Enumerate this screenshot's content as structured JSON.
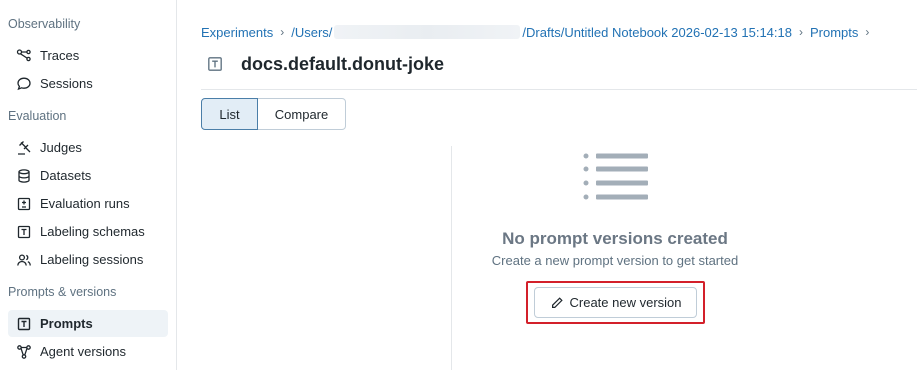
{
  "sidebar": {
    "sections": [
      {
        "title": "Observability",
        "items": [
          {
            "label": "Traces",
            "icon": "traces-icon"
          },
          {
            "label": "Sessions",
            "icon": "chat-bubble-icon"
          }
        ]
      },
      {
        "title": "Evaluation",
        "items": [
          {
            "label": "Judges",
            "icon": "gavel-icon"
          },
          {
            "label": "Datasets",
            "icon": "database-icon"
          },
          {
            "label": "Evaluation runs",
            "icon": "plus-minus-icon"
          },
          {
            "label": "Labeling schemas",
            "icon": "text-box-icon"
          },
          {
            "label": "Labeling sessions",
            "icon": "users-icon"
          }
        ]
      },
      {
        "title": "Prompts & versions",
        "items": [
          {
            "label": "Prompts",
            "icon": "text-box-icon",
            "active": true
          },
          {
            "label": "Agent versions",
            "icon": "agent-icon"
          }
        ]
      }
    ]
  },
  "breadcrumb": {
    "experiments": "Experiments",
    "users": "/Users/",
    "notebook": "/Drafts/Untitled Notebook 2026-02-13 15:14:18",
    "prompts": "Prompts"
  },
  "page": {
    "title": "docs.default.donut-joke",
    "title_icon": "text-box-icon"
  },
  "tabs": {
    "list": "List",
    "compare": "Compare",
    "selected": "List"
  },
  "empty_state": {
    "icon": "list-icon",
    "title": "No prompt versions created",
    "subtitle": "Create a new prompt version to get started",
    "button_label": "Create new version",
    "button_icon": "pencil-icon"
  },
  "colors": {
    "link": "#2272b4",
    "highlight": "#d3202a",
    "active_tab_bg": "#e2edf6"
  }
}
